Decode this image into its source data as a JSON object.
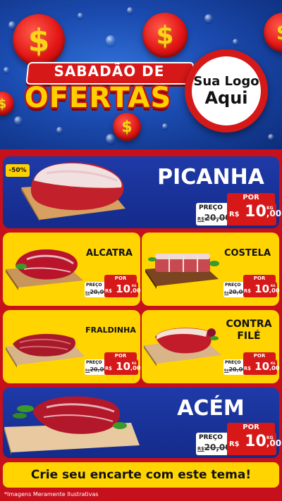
{
  "header": {
    "title_line1": "SABADÃO DE",
    "title_line2": "OFERTAS",
    "coin_symbol": "$",
    "logo_line1": "Sua Logo",
    "logo_line2": "Aqui"
  },
  "colors": {
    "red": "#d61818",
    "yellow": "#ffd400",
    "blue": "#1f3aa8"
  },
  "products": {
    "picanha": {
      "name": "PICANHA",
      "badge": "-50%",
      "por": "POR",
      "preco": "PREÇO",
      "old_rs": "R$",
      "old": "20,00",
      "new_rs": "R$",
      "new_int": "10",
      "new_cents": ",00",
      "kg": "KG",
      "icon": "picanha-meat-image"
    },
    "alcatra": {
      "name": "ALCATRA",
      "por": "POR",
      "preco": "PREÇO",
      "old_rs": "R$",
      "old": "20,00",
      "new_rs": "R$",
      "new_int": "10",
      "new_cents": ",00",
      "kg": "KG",
      "icon": "alcatra-meat-image"
    },
    "costela": {
      "name": "COSTELA",
      "por": "POR",
      "preco": "PREÇO",
      "old_rs": "R$",
      "old": "20,00",
      "new_rs": "R$",
      "new_int": "10",
      "new_cents": ",00",
      "kg": "KG",
      "icon": "costela-meat-image"
    },
    "fraldinha": {
      "name": "FRALDINHA",
      "por": "POR",
      "preco": "PREÇO",
      "old_rs": "R$",
      "old": "20,00",
      "new_rs": "R$",
      "new_int": "10",
      "new_cents": ",00",
      "kg": "KG",
      "icon": "fraldinha-meat-image"
    },
    "contrafile": {
      "name_line1": "CONTRA",
      "name_line2": "FILÉ",
      "por": "POR",
      "preco": "PREÇO",
      "old_rs": "R$",
      "old": "20,00",
      "new_rs": "R$",
      "new_int": "10",
      "new_cents": ",00",
      "kg": "KG",
      "icon": "contrafile-meat-image"
    },
    "acem": {
      "name": "ACÉM",
      "por": "POR",
      "preco": "PREÇO",
      "old_rs": "R$",
      "old": "20,00",
      "new_rs": "R$",
      "new_int": "10",
      "new_cents": ",00",
      "kg": "KG",
      "icon": "acem-meat-image"
    }
  },
  "footer": {
    "cta": "Crie seu encarte com este tema!",
    "disclaimer": "*Imagens Meramente Ilustrativas"
  }
}
